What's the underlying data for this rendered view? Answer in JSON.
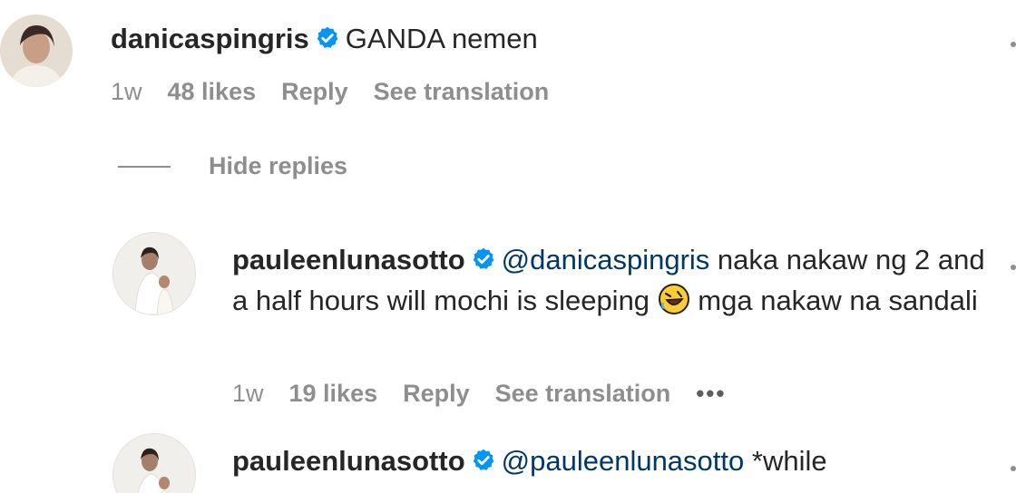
{
  "comments": [
    {
      "username": "danicaspingris",
      "text": "GANDA nemen",
      "time": "1w",
      "likes": "48 likes",
      "reply": "Reply",
      "see_translation": "See translation"
    }
  ],
  "hide_replies": "Hide replies",
  "replies": [
    {
      "username": "pauleenlunasotto",
      "mention": "@danicaspingris",
      "text_part1": " naka nakaw ng 2 and a half hours will mochi is sleeping ",
      "emoji": "rolling-on-floor-laughing-emoji",
      "text_part2": " mga nakaw na sandali",
      "time": "1w",
      "likes": "19 likes",
      "reply": "Reply",
      "see_translation": "See translation",
      "more": "•••"
    },
    {
      "username": "pauleenlunasotto",
      "mention": "@pauleenlunasotto",
      "text": " *while"
    }
  ],
  "colors": {
    "verified": "#0095f6",
    "mention": "#00376b",
    "meta": "#8e8e8e",
    "text": "#262626"
  }
}
